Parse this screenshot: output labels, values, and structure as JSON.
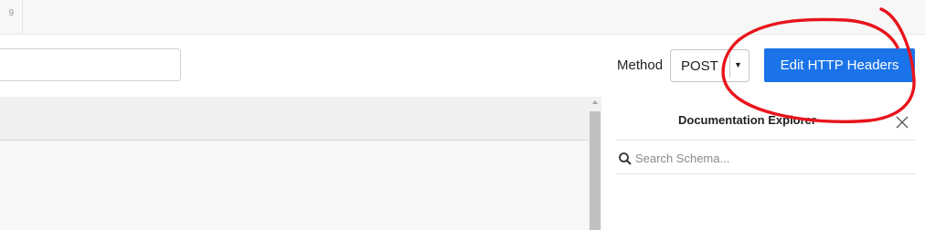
{
  "topbar": {
    "tab_fragment": "9"
  },
  "request": {
    "url_value": "",
    "method_label": "Method",
    "method_value": "POST",
    "edit_headers_label": "Edit HTTP Headers"
  },
  "doc_explorer": {
    "title": "Documentation Explorer",
    "search_placeholder": "Search Schema..."
  },
  "colors": {
    "accent": "#1a73e8",
    "annotation": "#e8141c"
  },
  "icons": [
    "chevron-down-icon",
    "close-icon",
    "search-icon"
  ]
}
